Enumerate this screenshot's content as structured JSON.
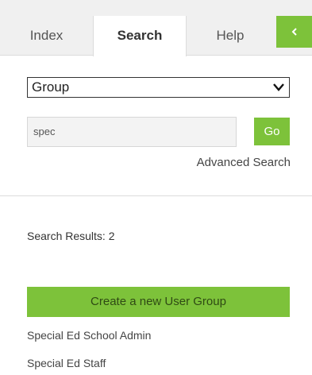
{
  "tabs": {
    "index": "Index",
    "search": "Search",
    "help": "Help"
  },
  "collapse_icon": "chevron-left-icon",
  "search_form": {
    "type_selected": "Group",
    "query_value": "spec",
    "go_label": "Go",
    "advanced_label": "Advanced Search"
  },
  "results": {
    "count_text": "Search Results: 2",
    "create_label": "Create a new User Group",
    "items": [
      "Special Ed School Admin",
      "Special Ed Staff"
    ]
  },
  "colors": {
    "accent": "#7dc23a",
    "tabbar_bg": "#f0f0f0",
    "input_bg": "#f3f3f3"
  }
}
